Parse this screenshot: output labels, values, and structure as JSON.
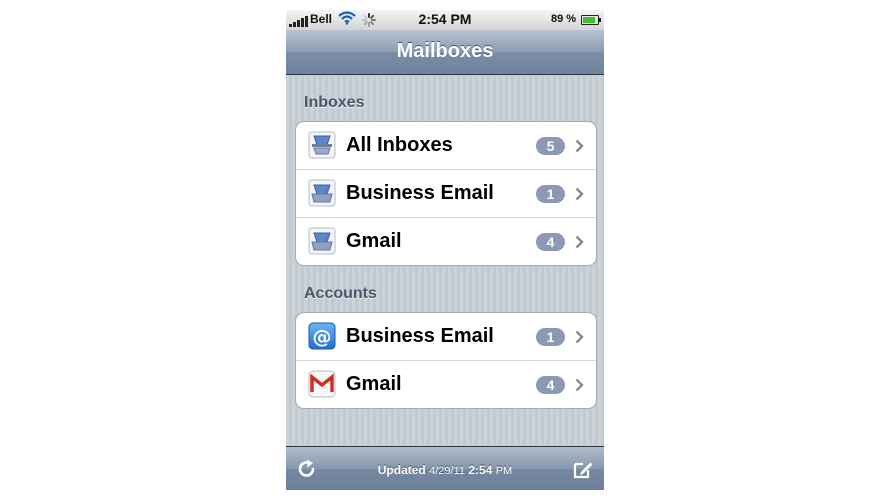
{
  "status_bar": {
    "carrier": "Bell",
    "time": "2:54 PM",
    "battery_percent": "89 %",
    "battery_level": 0.89,
    "battery_color": "#3cc12f"
  },
  "nav": {
    "title": "Mailboxes"
  },
  "inboxes": {
    "header": "Inboxes",
    "items": [
      {
        "label": "All Inboxes",
        "count": "5",
        "icon": "all-inboxes-tray-icon"
      },
      {
        "label": "Business Email",
        "count": "1",
        "icon": "inbox-tray-icon"
      },
      {
        "label": "Gmail",
        "count": "4",
        "icon": "inbox-tray-icon"
      }
    ]
  },
  "accounts": {
    "header": "Accounts",
    "items": [
      {
        "label": "Business Email",
        "count": "1",
        "icon": "at-sign-icon"
      },
      {
        "label": "Gmail",
        "count": "4",
        "icon": "gmail-icon"
      }
    ]
  },
  "toolbar": {
    "updated_label": "Updated",
    "updated_date": "4/29/11",
    "updated_time": "2:54",
    "updated_ampm": "PM"
  },
  "colors": {
    "badge": "#8c99b4",
    "nav_bar": "#7a8ea6",
    "section_text": "#4c566c"
  }
}
